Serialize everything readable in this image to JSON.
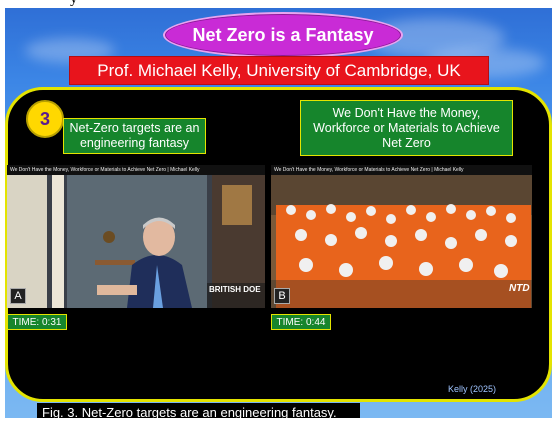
{
  "slide": {
    "title": "Net Zero is a Fantasy",
    "subtitle": "Prof. Michael Kelly, University of Cambridge, UK",
    "number": "3",
    "credit": "Kelly (2025)",
    "caption": "Fig. 3. Net-Zero targets are an engineering fantasy.",
    "top_text": "y"
  },
  "left": {
    "label": "Net-Zero targets are an engineering fantasy",
    "video_title": "We Don't Have the Money, Workforce or Materials to Achieve Net Zero | Michael Kelly",
    "letter": "A",
    "time": "TIME: 0:31",
    "watermark": "BRITISH DOE"
  },
  "right": {
    "label": "We Don't Have the Money, Workforce or Materials to Achieve Net Zero",
    "video_title": "We Don't Have the Money, Workforce or Materials to Achieve Net Zero | Michael Kelly",
    "letter": "B",
    "time": "TIME: 0:44",
    "watermark": "NTD"
  },
  "colors": {
    "title_oval": "#c92bd6",
    "subtitle_bg": "#e8141c",
    "panel_border": "#e4e400",
    "green_box": "#16852c",
    "number_circle": "#ffd800"
  }
}
